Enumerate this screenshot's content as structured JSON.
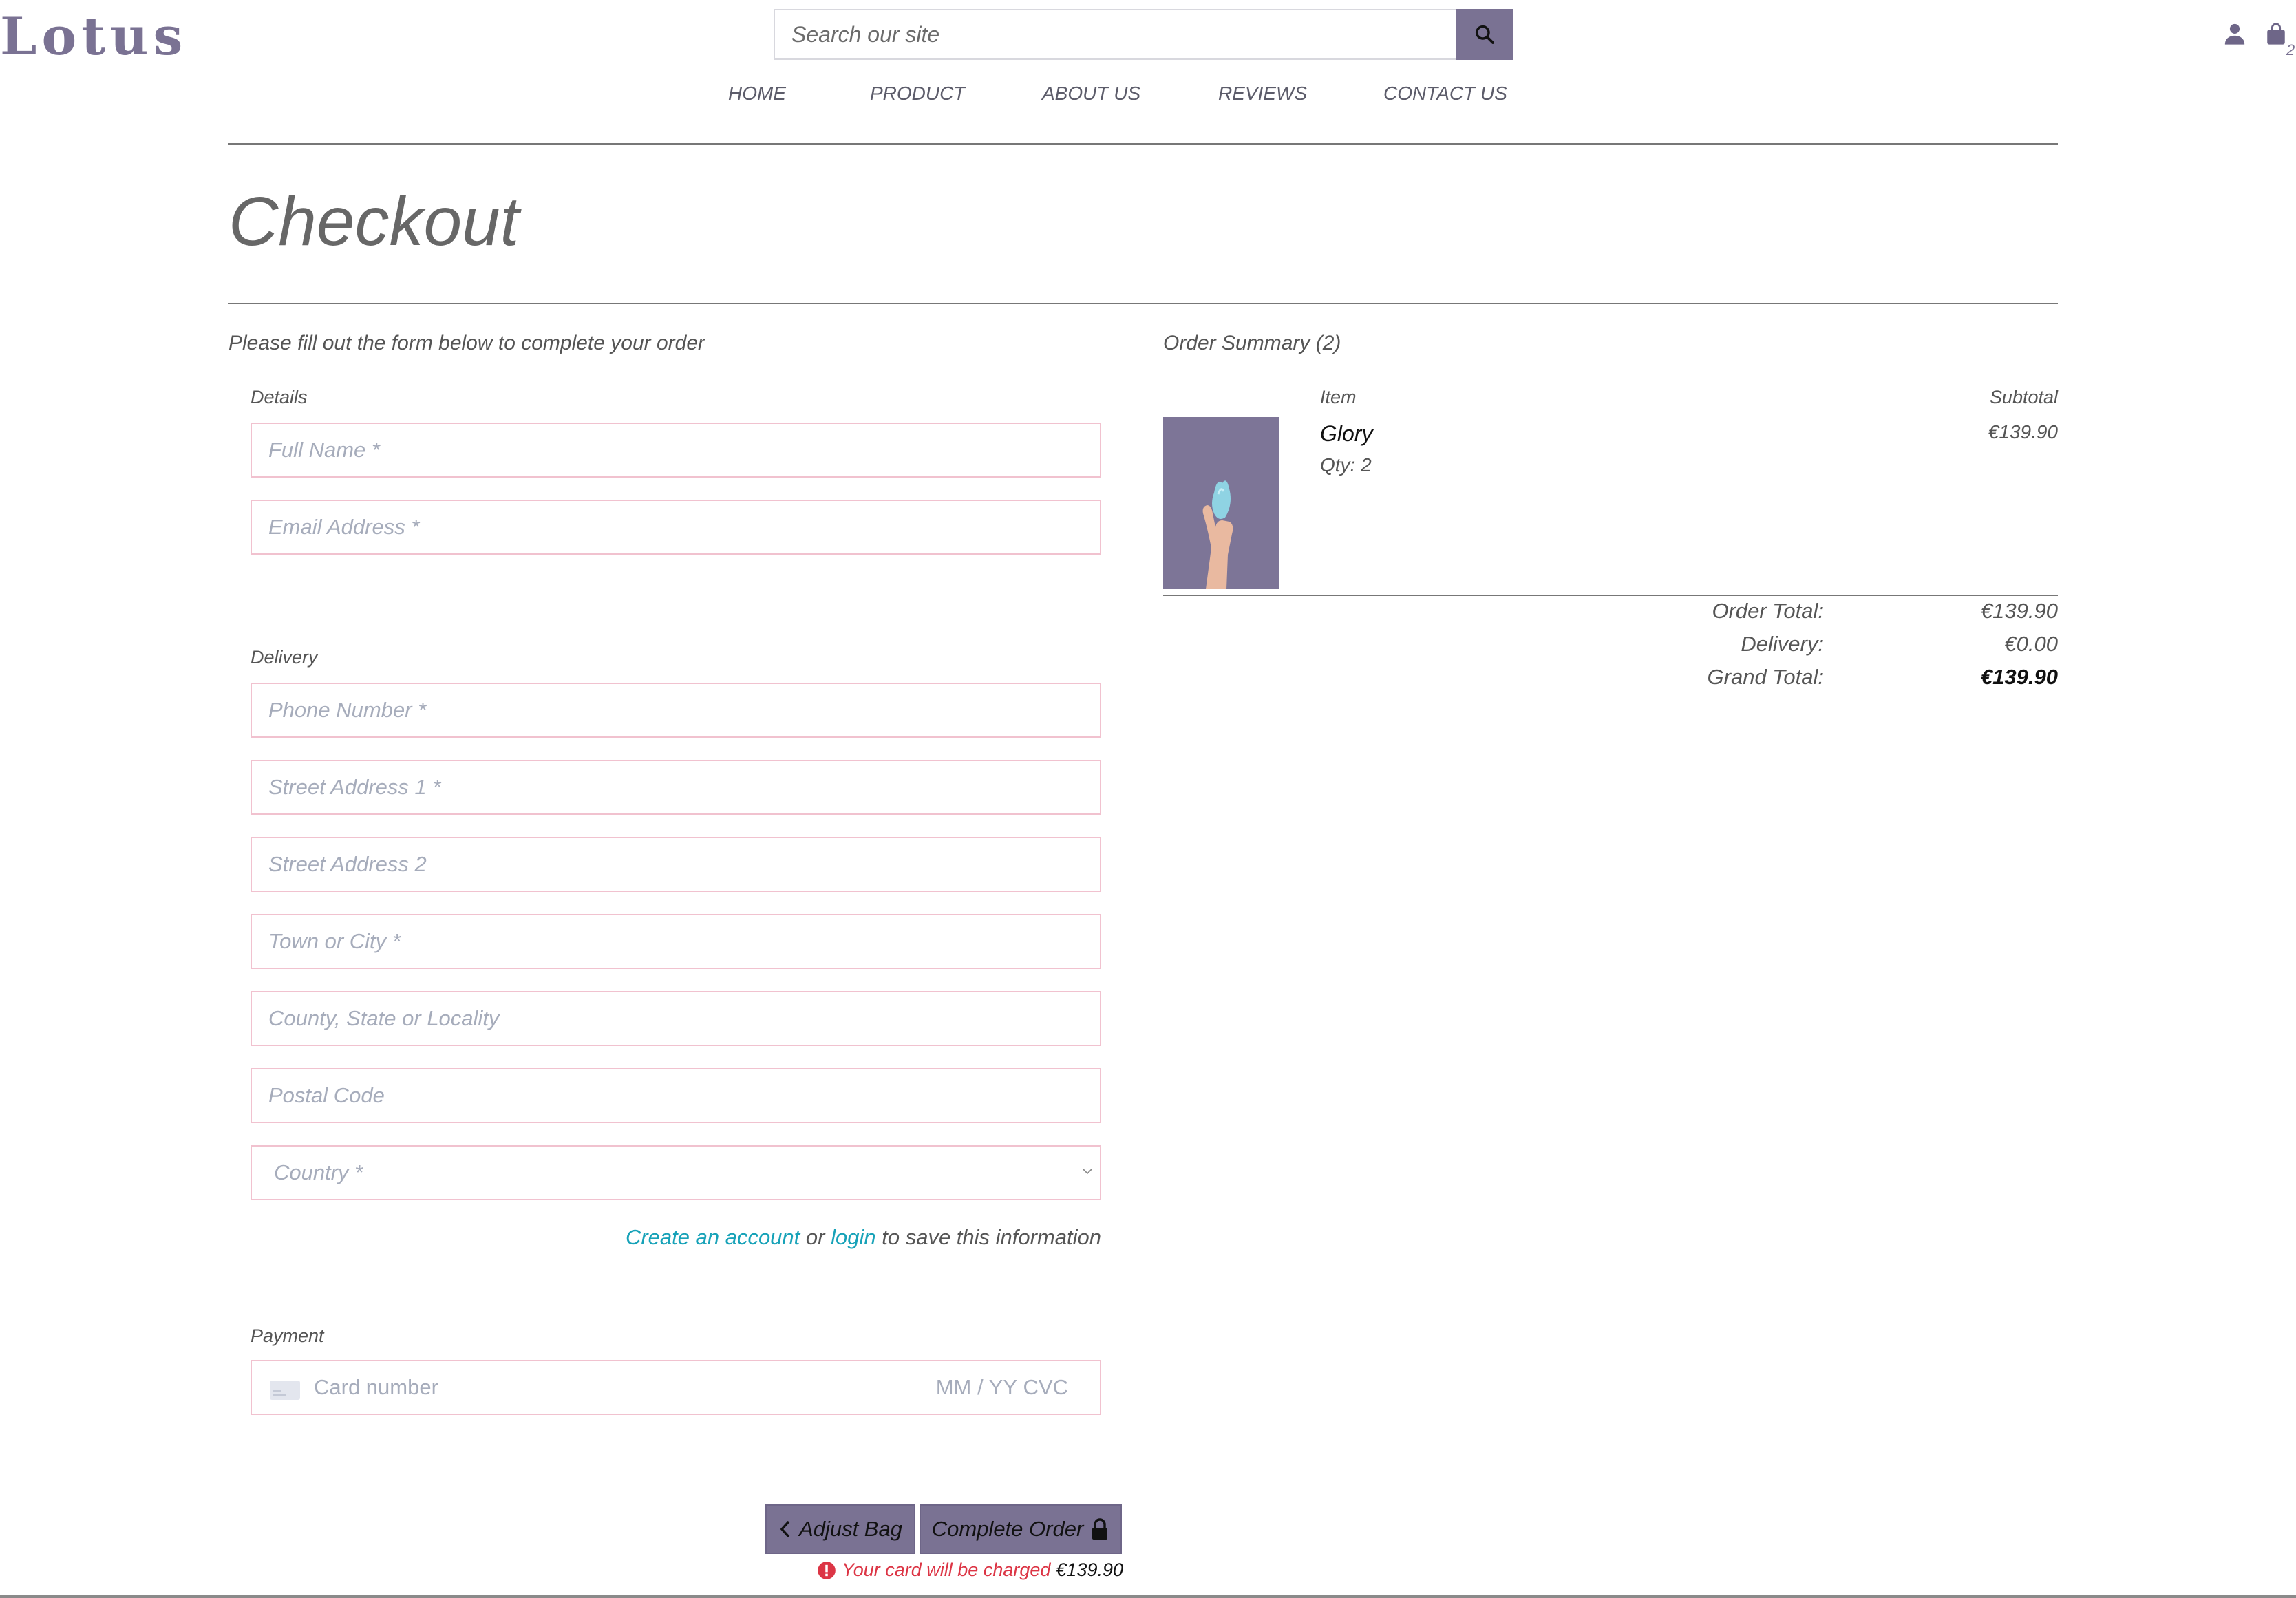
{
  "brand": {
    "logo": "Lotus"
  },
  "search": {
    "placeholder": "Search our site",
    "icon": "search-icon"
  },
  "nav": {
    "items": [
      {
        "label": "HOME"
      },
      {
        "label": "PRODUCT"
      },
      {
        "label": "ABOUT US"
      },
      {
        "label": "REVIEWS"
      },
      {
        "label": "CONTACT US"
      }
    ]
  },
  "header_icons": {
    "account": "user-icon",
    "bag": "shopping-bag-icon",
    "bag_count": "2"
  },
  "page": {
    "title": "Checkout"
  },
  "form": {
    "intro": "Please fill out the form below to complete your order",
    "details_legend": "Details",
    "full_name_placeholder": "Full Name *",
    "email_placeholder": "Email Address *",
    "delivery_legend": "Delivery",
    "phone_placeholder": "Phone Number *",
    "street1_placeholder": "Street Address 1 *",
    "street2_placeholder": "Street Address 2",
    "town_placeholder": "Town or City *",
    "county_placeholder": "County, State or Locality",
    "postcode_placeholder": "Postal Code",
    "country_selected": "Country *",
    "save_create": "Create an account",
    "save_or": "or",
    "save_login": "login",
    "save_rest": "to save this information",
    "payment_legend": "Payment",
    "card_number_placeholder": "Card number",
    "card_expiry_placeholder": "MM / YY",
    "card_cvc_placeholder": "CVC"
  },
  "actions": {
    "adjust_label": "Adjust Bag",
    "complete_label": "Complete Order",
    "charge_text": "Your card will be charged",
    "charge_amount": "€139.90"
  },
  "summary": {
    "title": "Order Summary (2)",
    "col_item": "Item",
    "col_subtotal": "Subtotal",
    "items": [
      {
        "name": "Glory",
        "qty": "Qty: 2",
        "subtotal": "€139.90"
      }
    ],
    "order_total_label": "Order Total:",
    "order_total": "€139.90",
    "delivery_label": "Delivery:",
    "delivery": "€0.00",
    "grand_total_label": "Grand Total:",
    "grand_total": "€139.90"
  },
  "colors": {
    "accent": "#7a7293",
    "field_border": "#f1c2cf",
    "link": "#17a2b8",
    "warning": "#dc3545"
  }
}
